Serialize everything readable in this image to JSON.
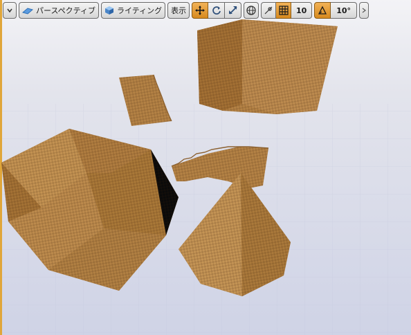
{
  "toolbar": {
    "menu_icon": "chevron-down-icon",
    "perspective_label": "パースペクティブ",
    "lighting_label": "ライティング",
    "show_label": "表示",
    "grid_snap_value": "10",
    "rotation_snap_value": "10°"
  },
  "colors": {
    "accent_active": "#e89b2e",
    "wood_light": "#c29557",
    "wood_mid": "#a87a3e",
    "wood_dark": "#7d5527",
    "floor": "#d3d6e6",
    "sky": "#e8e9f0"
  }
}
